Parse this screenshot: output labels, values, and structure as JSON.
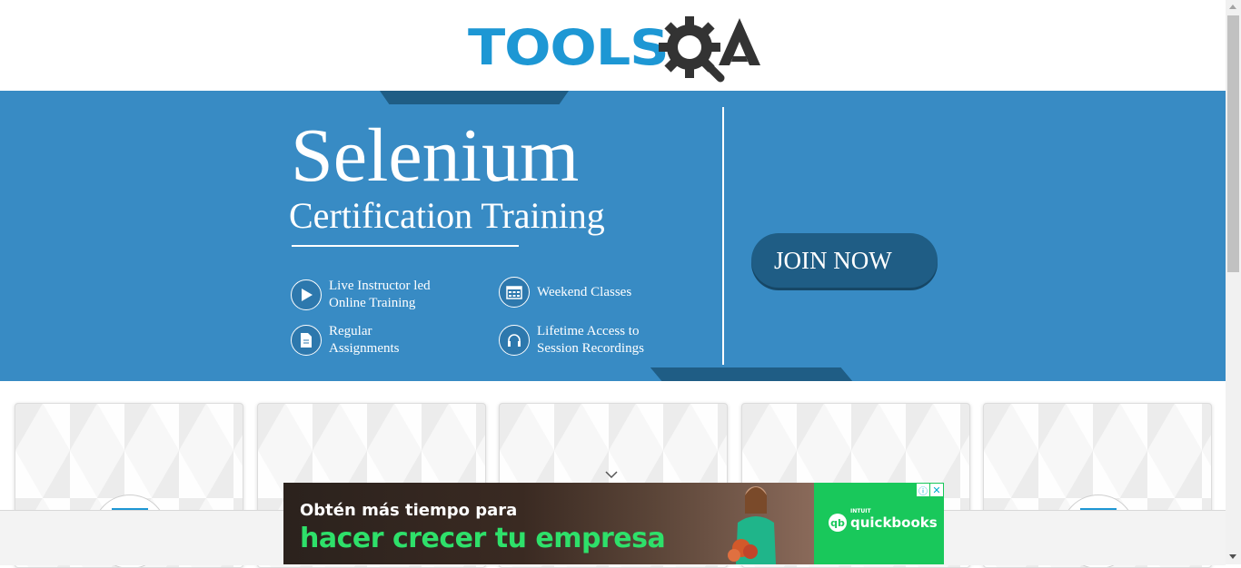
{
  "header": {
    "logo_text": "TOOLS",
    "logo_alt": "ToolsQA"
  },
  "banner": {
    "title": "Selenium",
    "subtitle": "Certification Training",
    "features": [
      {
        "label": "Live Instructor led\nOnline Training",
        "icon": "play-icon"
      },
      {
        "label": "Weekend Classes",
        "icon": "calendar-icon"
      },
      {
        "label": "Regular\nAssignments",
        "icon": "document-icon"
      },
      {
        "label": "Lifetime Access to\nSession Recordings",
        "icon": "headphones-icon"
      }
    ],
    "join_label": "JOIN NOW",
    "colors": {
      "background": "#388bc4",
      "accent_dark": "#1f5d85",
      "logo_blue": "#1d97d4"
    }
  },
  "cards": {
    "count": 5
  },
  "ad": {
    "line1": "Obtén más tiempo para",
    "line2": "hacer crecer tu empresa",
    "brand_small": "INTUIT",
    "brand": "quickbooks",
    "brand_mark": "qb",
    "info_icon": "ⓘ",
    "close_icon": "✕",
    "colors": {
      "green": "#19c85b",
      "headline_green": "#2ee06a"
    }
  }
}
